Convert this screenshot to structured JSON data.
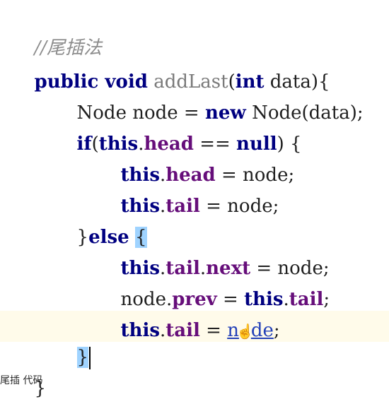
{
  "code": {
    "comment": "//尾插法",
    "line1": {
      "kw": "public void",
      "method": "addLast",
      "open": "(",
      "kw2": "int",
      "rest": " data){"
    },
    "line2": {
      "pre": "Node node = ",
      "kw": "new",
      "post": " Node(data);"
    },
    "line3": {
      "kw": "if",
      "open": "(",
      "this": "this",
      "dot": ".",
      "field": "head",
      "eq": " == ",
      "null": "null",
      "close": ") {"
    },
    "line4": {
      "this": "this",
      "dot": ".",
      "field": "head",
      "rest": " = node;"
    },
    "line5": {
      "this": "this",
      "dot": ".",
      "field": "tail",
      "rest": " = node;"
    },
    "line6": {
      "brace": "}",
      "kw": "else",
      "space": " ",
      "openbrace": "{"
    },
    "line7": {
      "this": "this",
      "dot1": ".",
      "field1": "tail",
      "dot2": ".",
      "field2": "next",
      "rest": " = node;"
    },
    "line8": {
      "pre": "node.",
      "field": "prev",
      "eq": " = ",
      "this": "this",
      "dot": ".",
      "field2": "tail",
      "semi": ";"
    },
    "line9": {
      "this": "this",
      "dot": ".",
      "field": "tail",
      "eq": " = ",
      "link_a": "n",
      "link_b": "de",
      "semi": ";"
    },
    "line10": {
      "brace": "}"
    },
    "line11": {
      "brace": "}"
    }
  },
  "bottom_text": "尾插   代码"
}
